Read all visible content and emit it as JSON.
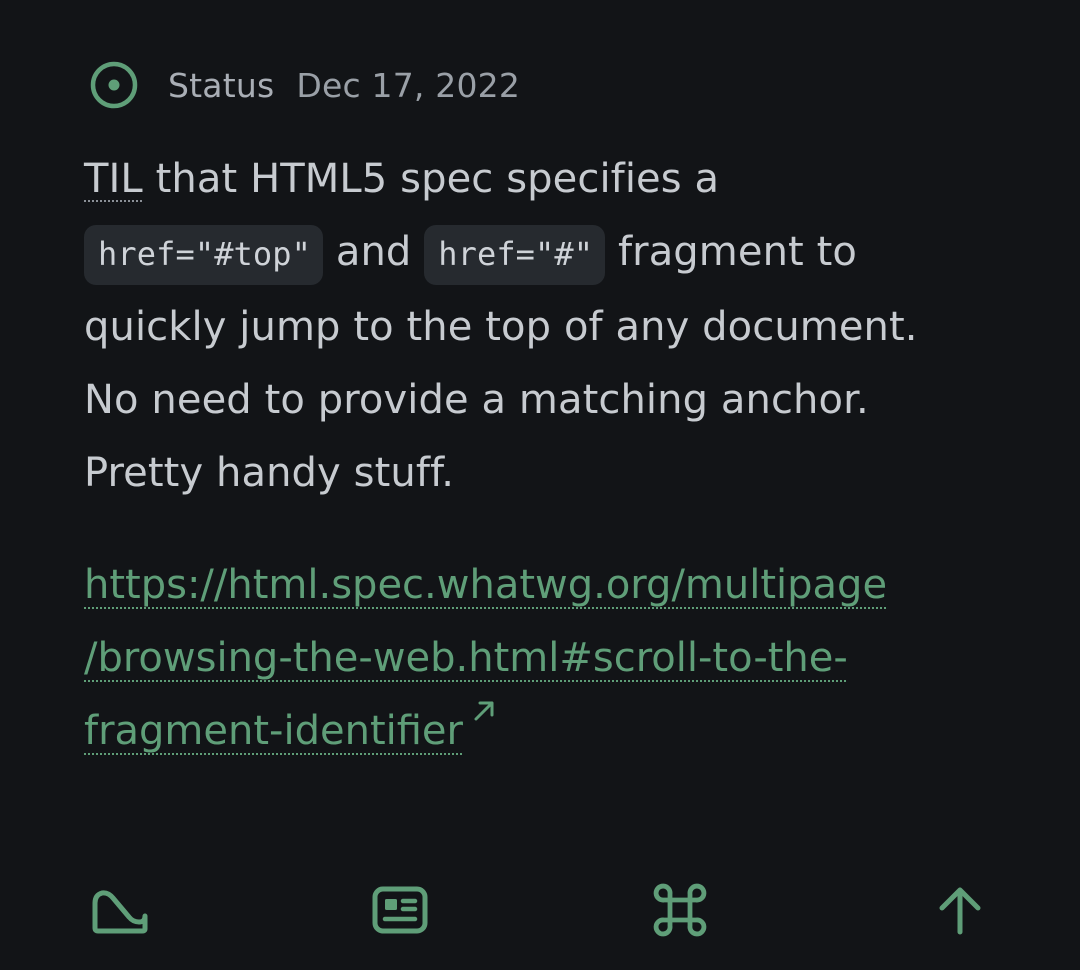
{
  "post": {
    "type_label": "Status",
    "date": "Dec 17, 2022",
    "body": {
      "abbr": "TIL",
      "text_1": " that HTML5 spec specifies a ",
      "code_1": "href=\"#top\"",
      "text_2": " and ",
      "code_2": "href=\"#\"",
      "text_3": " fragment to quickly jump to the top of any document. No need to provide a matching anchor. Pretty handy stuff."
    },
    "link": {
      "line_1": "https://html.spec.whatwg.org/multipage",
      "line_2": "/browsing-the-web.html#scroll-to-the-",
      "line_3": "fragment-identifier"
    }
  },
  "toolbar": {
    "items": [
      {
        "icon": "home-icon"
      },
      {
        "icon": "reader-icon"
      },
      {
        "icon": "command-icon"
      },
      {
        "icon": "arrow-up-icon"
      }
    ]
  },
  "colors": {
    "background": "#121417",
    "accent": "#5f9e78",
    "text": "#c7cbd0",
    "muted": "#9aa0a7",
    "code_bg": "#262a2f"
  }
}
